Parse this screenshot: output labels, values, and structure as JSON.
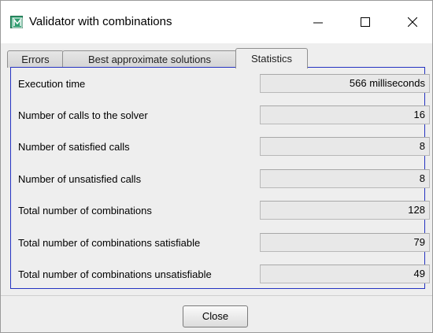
{
  "window": {
    "title": "Validator with combinations"
  },
  "tabs": [
    {
      "label": "Errors",
      "active": false
    },
    {
      "label": "Best approximate solutions",
      "active": false
    },
    {
      "label": "Statistics",
      "active": true
    }
  ],
  "statistics": [
    {
      "label": "Execution time",
      "value": "566 milliseconds"
    },
    {
      "label": "Number of calls to the solver",
      "value": "16"
    },
    {
      "label": "Number of satisfied calls",
      "value": "8"
    },
    {
      "label": "Number of unsatisfied calls",
      "value": "8"
    },
    {
      "label": "Total number of combinations",
      "value": "128"
    },
    {
      "label": "Total number of combinations satisfiable",
      "value": "79"
    },
    {
      "label": "Total number of combinations unsatisfiable",
      "value": "49"
    }
  ],
  "footer": {
    "close_label": "Close"
  },
  "colors": {
    "panel_border": "#2433c2",
    "icon_green": "#2f9c6f"
  },
  "icons": {
    "app": "app-logo-icon",
    "minimize": "minimize-icon",
    "maximize": "maximize-icon",
    "close": "close-icon"
  }
}
